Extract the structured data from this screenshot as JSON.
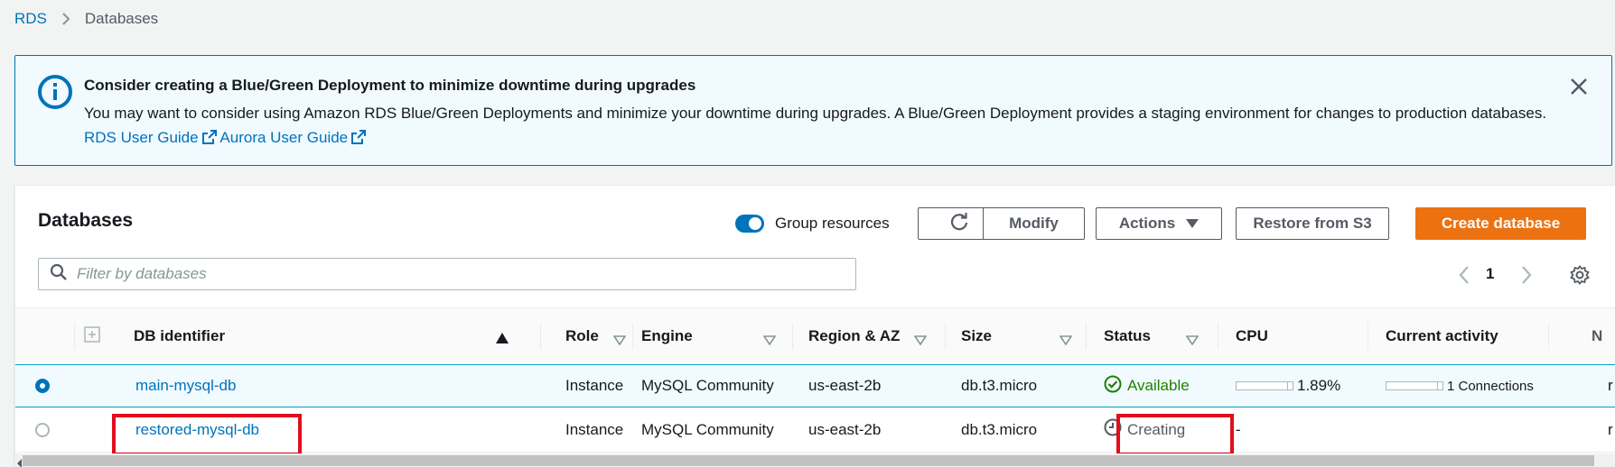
{
  "breadcrumb": {
    "root": "RDS",
    "current": "Databases"
  },
  "flash": {
    "title": "Consider creating a Blue/Green Deployment to minimize downtime during upgrades",
    "body_text": "You may want to consider using Amazon RDS Blue/Green Deployments and minimize your downtime during upgrades. A Blue/Green Deployment provides a staging environment for changes to production databases.",
    "link1": "RDS User Guide",
    "link2": "Aurora User Guide"
  },
  "panel": {
    "title": "Databases",
    "group_resources_label": "Group resources",
    "buttons": {
      "modify": "Modify",
      "actions": "Actions",
      "restore_s3": "Restore from S3",
      "create": "Create database"
    },
    "filter_placeholder": "Filter by databases",
    "page_number": "1"
  },
  "table": {
    "columns": {
      "db_identifier": "DB identifier",
      "role": "Role",
      "engine": "Engine",
      "region": "Region & AZ",
      "size": "Size",
      "status": "Status",
      "cpu": "CPU",
      "activity": "Current activity"
    },
    "rows": [
      {
        "id": "main-mysql-db",
        "role": "Instance",
        "engine": "MySQL Community",
        "region": "us-east-2b",
        "size": "db.t3.micro",
        "status": "Available",
        "cpu": "1.89%",
        "activity": "1 Connections",
        "extra": "r"
      },
      {
        "id": "restored-mysql-db",
        "role": "Instance",
        "engine": "MySQL Community",
        "region": "us-east-2b",
        "size": "db.t3.micro",
        "status": "Creating",
        "cpu": "-",
        "activity": "",
        "extra": "r"
      }
    ]
  },
  "colors": {
    "link": "#0073bb",
    "primary": "#ec7211",
    "success": "#1d8102",
    "highlight": "#e10e1d",
    "info_border": "#0073bb"
  }
}
